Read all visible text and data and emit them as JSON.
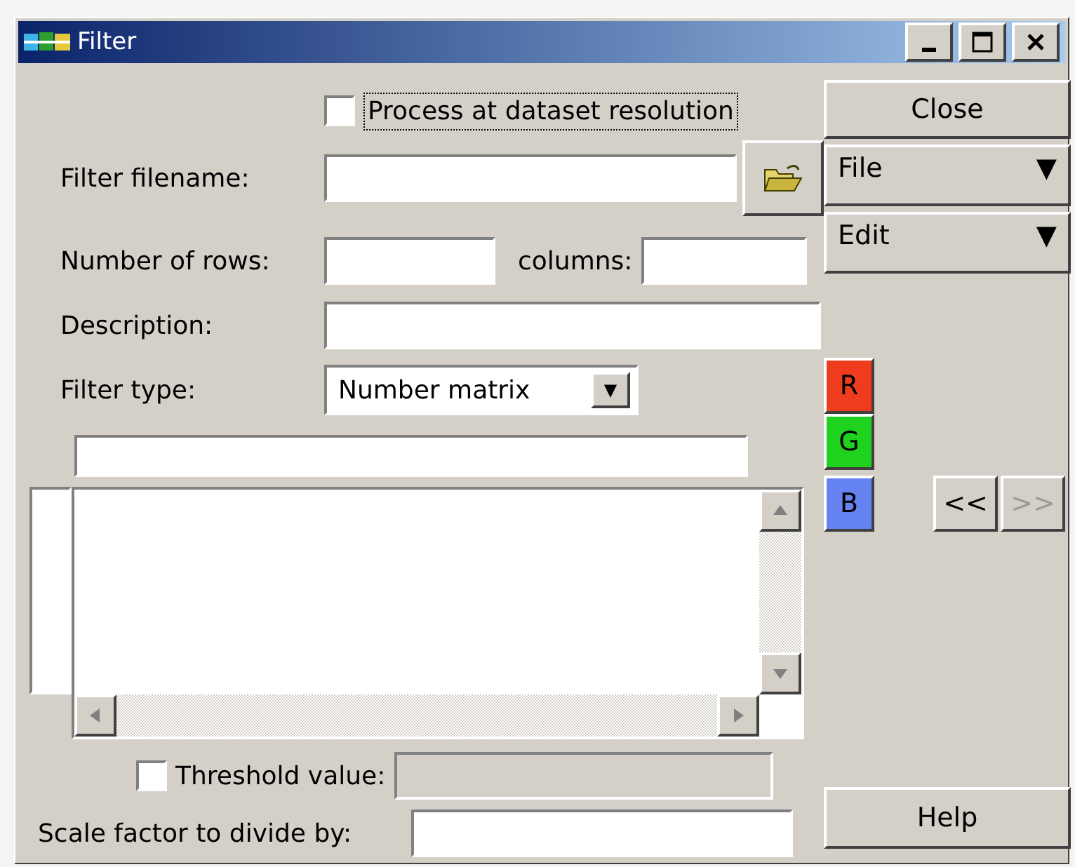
{
  "window": {
    "title": "Filter",
    "controls": [
      {
        "kind": "minimize"
      },
      {
        "kind": "maximize"
      },
      {
        "kind": "close"
      }
    ]
  },
  "resolution_option": {
    "label": "Process at dataset resolution",
    "checked": false
  },
  "filename": {
    "label": "Filter filename:"
  },
  "rows": {
    "label": "Number of rows:"
  },
  "columns": {
    "label": "columns:"
  },
  "description": {
    "label": "Description:"
  },
  "filter_type": {
    "label": "Filter type:",
    "value": "Number matrix"
  },
  "threshold": {
    "label": "Threshold value:",
    "checked": false,
    "disabled": true
  },
  "scale": {
    "label": "Scale factor to divide by:"
  },
  "buttons": {
    "close": "Close",
    "help": "Help"
  },
  "menus": [
    {
      "label": "File",
      "arrow": "▼"
    },
    {
      "label": "Edit",
      "arrow": "▼"
    }
  ],
  "channels": [
    {
      "label": "R",
      "color": "#f03c1e"
    },
    {
      "label": "G",
      "color": "#1ed21e"
    },
    {
      "label": "B",
      "color": "#6482f0"
    }
  ],
  "navigation": [
    {
      "label": "<<",
      "disabled": false
    },
    {
      "label": ">>",
      "disabled": true
    }
  ]
}
